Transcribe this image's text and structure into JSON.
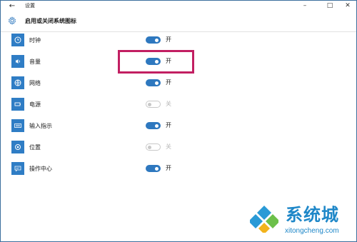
{
  "window": {
    "back_icon": "back-arrow-icon",
    "title": "设置",
    "controls": [
      "minimize-icon",
      "maximize-icon",
      "close-icon"
    ]
  },
  "header": {
    "icon": "gear-icon",
    "title": "启用或关闭系统图标"
  },
  "items": [
    {
      "label": "时钟",
      "icon": "clock-icon",
      "state": "开",
      "on": true
    },
    {
      "label": "音量",
      "icon": "speaker-icon",
      "state": "开",
      "on": true
    },
    {
      "label": "网络",
      "icon": "network-icon",
      "state": "开",
      "on": true
    },
    {
      "label": "电源",
      "icon": "battery-icon",
      "state": "关",
      "on": false
    },
    {
      "label": "输入指示",
      "icon": "keyboard-icon",
      "state": "开",
      "on": true
    },
    {
      "label": "位置",
      "icon": "location-icon",
      "state": "关",
      "on": false
    },
    {
      "label": "操作中心",
      "icon": "action-center-icon",
      "state": "开",
      "on": true
    }
  ],
  "annotation": {
    "highlight_color": "#c21f62",
    "highlighted_item": "音量"
  },
  "colors": {
    "accent": "#2e78bf",
    "icon_tile": "#2f7dc5",
    "toggle_off": "#c8c8c8"
  },
  "watermark": {
    "brand": "系统城",
    "url": "xitongcheng.com"
  }
}
